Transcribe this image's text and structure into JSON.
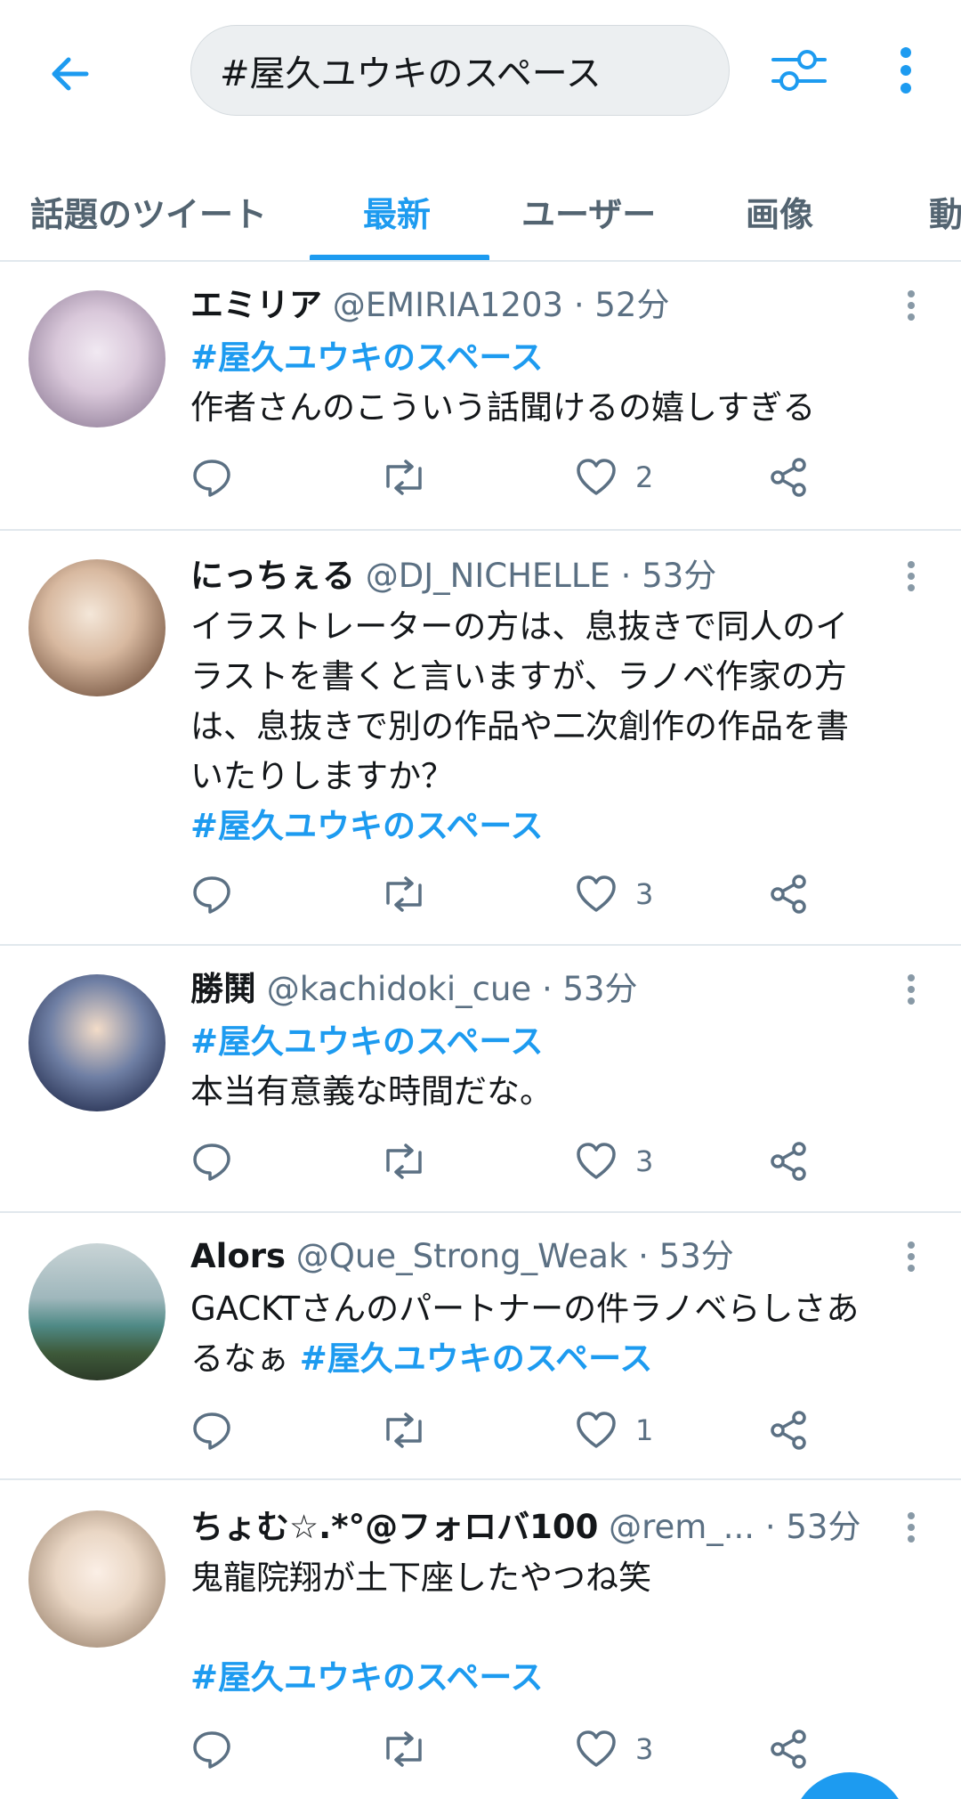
{
  "search": {
    "query": "#屋久ユウキのスペース"
  },
  "tabs": [
    {
      "label": "話題のツイート"
    },
    {
      "label": "最新"
    },
    {
      "label": "ユーザー"
    },
    {
      "label": "画像"
    },
    {
      "label": "動"
    }
  ],
  "tweets": [
    {
      "name": "エミリア",
      "handle": "@EMIRIA1203",
      "time": "· 52分",
      "lines": [
        {
          "hashtag": "#屋久ユウキのスペース"
        },
        {
          "text": "作者さんのこういう話聞けるの嬉しすぎる"
        }
      ],
      "likes": "2"
    },
    {
      "name": "にっちぇる",
      "handle": "@DJ_NICHELLE",
      "time": "· 53分",
      "lines": [
        {
          "text": "イラストレーターの方は、息抜きで同人のイ"
        },
        {
          "text": "ラストを書くと言いますが、ラノベ作家の方"
        },
        {
          "text": "は、息抜きで別の作品や二次創作の作品を書"
        },
        {
          "text": "いたりしますか？"
        },
        {
          "hashtag": "#屋久ユウキのスペース"
        }
      ],
      "likes": "3"
    },
    {
      "name": "勝鬨",
      "handle": "@kachidoki_cue",
      "time": "· 53分",
      "lines": [
        {
          "hashtag": "#屋久ユウキのスペース"
        },
        {
          "text": "本当有意義な時間だな。"
        }
      ],
      "likes": "3"
    },
    {
      "name": "Alors",
      "handle": "@Que_Strong_Weak",
      "time": "· 53分",
      "lines": [
        {
          "text": "GACKTさんのパートナーの件ラノベらしさあ"
        },
        {
          "text": "るなぁ",
          "hashtag": "#屋久ユウキのスペース"
        }
      ],
      "likes": "1"
    },
    {
      "name": "ちょむ☆.*°@フォロバ100",
      "handle": "@rem_...",
      "time": "· 53分",
      "lines": [
        {
          "text": "鬼龍院翔が土下座したやつね笑"
        },
        {
          "text": ""
        },
        {
          "hashtag": " #屋久ユウキのスペース"
        }
      ],
      "likes": "3"
    }
  ],
  "colors": {
    "accent": "#1d9bf0",
    "muted": "#5b7083",
    "divider": "#e1e8ed"
  }
}
